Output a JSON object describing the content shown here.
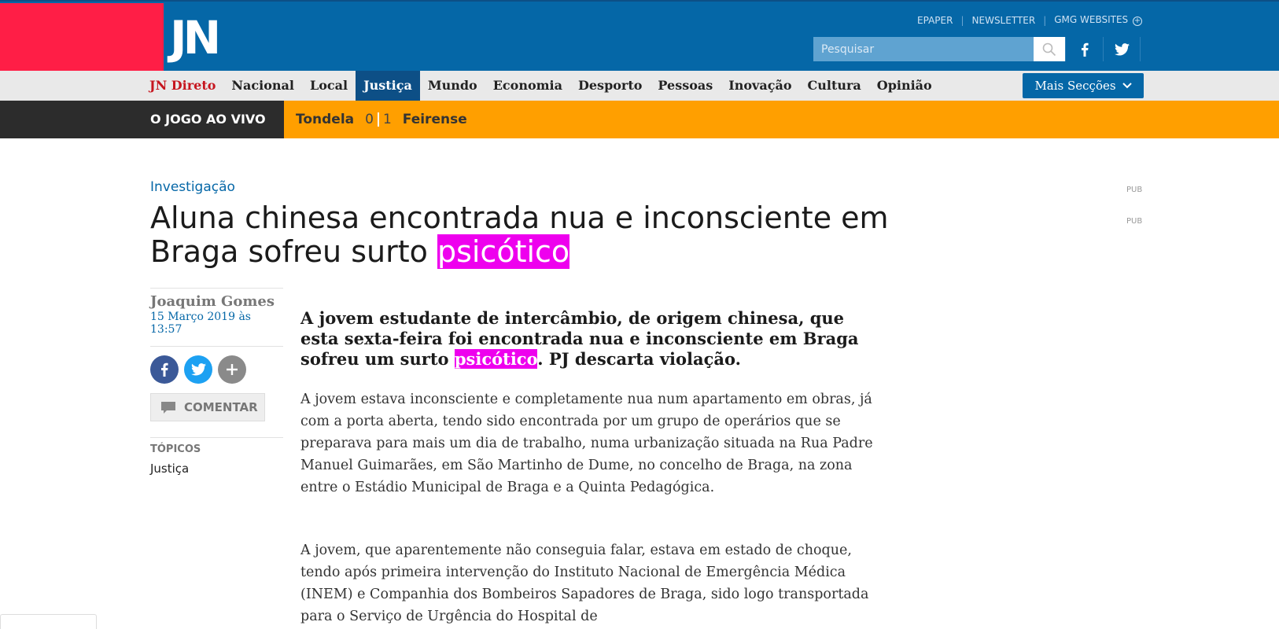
{
  "header": {
    "logo": "JN",
    "links": [
      "EPAPER",
      "NEWSLETTER",
      "GMG WEBSITES"
    ],
    "search_placeholder": "Pesquisar"
  },
  "nav": {
    "items": [
      "JN Direto",
      "Nacional",
      "Local",
      "Justiça",
      "Mundo",
      "Economia",
      "Desporto",
      "Pessoas",
      "Inovação",
      "Cultura",
      "Opinião"
    ],
    "active": "Justiça",
    "more_label": "Mais Secções"
  },
  "live": {
    "label": "O JOGO AO VIVO",
    "home_team": "Tondela",
    "home_score": "0",
    "away_score": "1",
    "away_team": "Feirense"
  },
  "article": {
    "section": "Investigação",
    "title_part1": "Aluna chinesa encontrada nua e inconsciente em Braga sofreu surto ",
    "title_highlight": "psicótico",
    "pub_labels": [
      "PUB",
      "PUB"
    ],
    "author": "Joaquim Gomes",
    "date": "15 Março 2019 às 13:57",
    "comment_label": "COMENTAR",
    "topics_heading": "TÓPICOS",
    "topics": [
      "Justiça"
    ],
    "lead_part1": "A jovem estudante de intercâmbio, de origem chinesa, que esta sexta-feira foi encontrada nua e inconsciente em Braga sofreu um surto ",
    "lead_highlight": "psicótico",
    "lead_part2": ". PJ descarta violação.",
    "paragraphs": [
      "A jovem estava inconsciente e completamente nua num apartamento em obras, já com a porta aberta, tendo sido encontrada por um grupo de operários que se preparava para mais um dia de trabalho, numa urbanização situada na Rua Padre Manuel Guimarães, em São Martinho de Dume, no concelho de Braga, na zona entre o Estádio Municipal de Braga e a Quinta Pedagógica.",
      "A jovem, que aparentemente não conseguia falar, estava em estado de choque, tendo após primeira intervenção do Instituto Nacional de Emergência Médica (INEM) e Companhia dos Bombeiros Sapadores de Braga, sido logo transportada para o Serviço de Urgência do Hospital de"
    ]
  },
  "colors": {
    "brand_blue": "#0567a7",
    "brand_red": "#ff1e46",
    "nav_active": "#0d4f86",
    "live_orange": "#ff9f00",
    "highlight": "#ee00ee"
  }
}
